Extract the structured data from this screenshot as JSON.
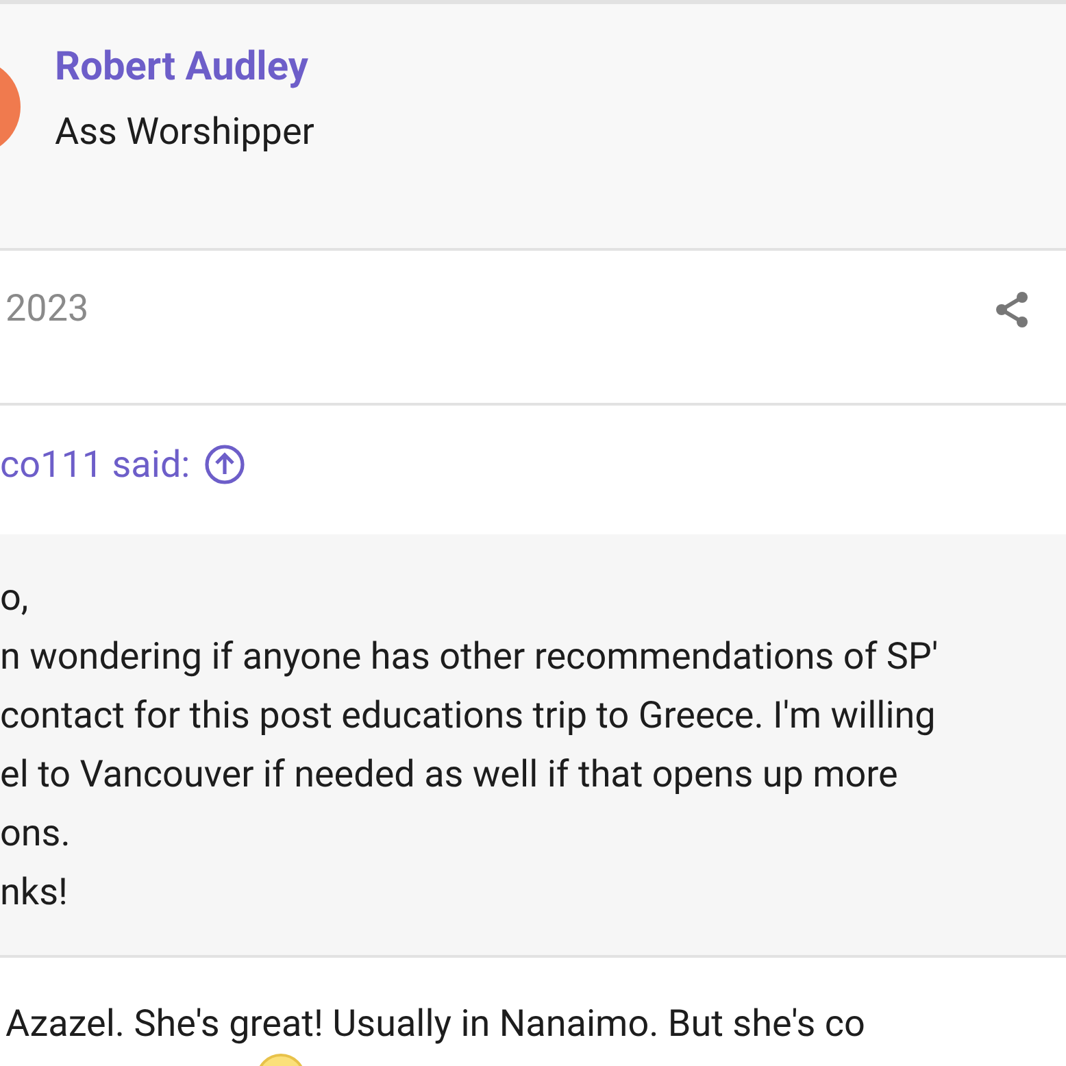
{
  "author": {
    "name": "Robert Audley",
    "title": "Ass Worshipper"
  },
  "post_meta": {
    "date": "2023"
  },
  "quote": {
    "attribution": "co111 said:",
    "lines": [
      "o,",
      "n wondering if anyone has other recommendations of SP'",
      "contact for this post educations trip to Greece. I'm willing",
      "el to Vancouver if needed as well if that opens up more",
      "ons.",
      "nks!"
    ]
  },
  "reply": {
    "text": "Azazel. She's great! Usually in Nanaimo. But she's co"
  }
}
